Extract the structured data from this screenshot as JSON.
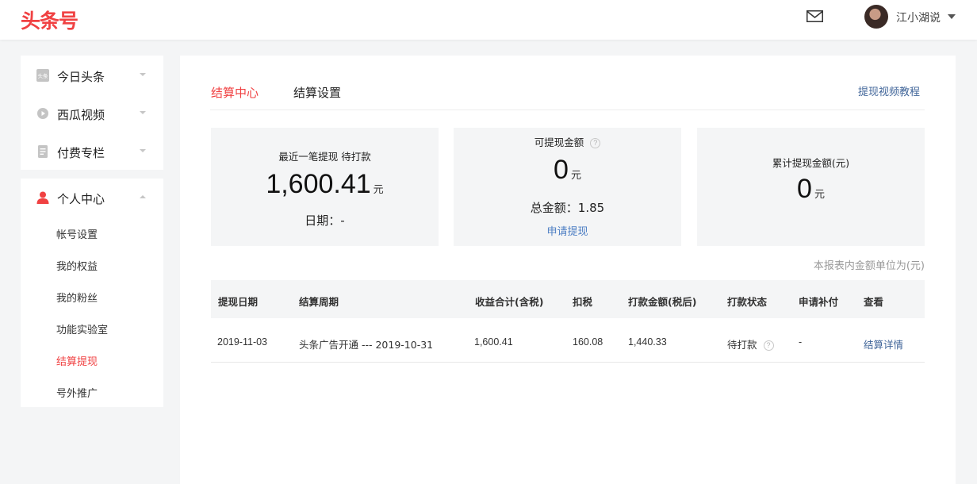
{
  "header": {
    "logo": "头条号",
    "username": "江小湖说"
  },
  "sidebar": {
    "group1": [
      {
        "label": "今日头条",
        "icon": "toutiao-icon"
      },
      {
        "label": "西瓜视频",
        "icon": "xigua-video-icon"
      },
      {
        "label": "付费专栏",
        "icon": "paid-column-icon"
      }
    ],
    "personal": {
      "label": "个人中心",
      "icon": "person-icon",
      "items": [
        "帐号设置",
        "我的权益",
        "我的粉丝",
        "功能实验室",
        "结算提现",
        "号外推广"
      ],
      "active_index": 4
    }
  },
  "main": {
    "tabs": [
      "结算中心",
      "结算设置"
    ],
    "active_tab": 0,
    "tutorial_link": "提现视频教程",
    "card_recent": {
      "title": "最近一笔提现 待打款",
      "amount": "1,600.41",
      "unit": "元",
      "date": "日期：-"
    },
    "card_withdrawable": {
      "title": "可提现金额",
      "help_icon": "?",
      "amount": "0",
      "unit": "元",
      "total": "总金额：1.85",
      "apply": "申请提现"
    },
    "card_cumulative": {
      "title": "累计提现金额(元)",
      "amount": "0",
      "unit": "元"
    },
    "unit_note": "本报表内金额单位为(元)",
    "table": {
      "headers": [
        "提现日期",
        "结算周期",
        "收益合计(含税)",
        "扣税",
        "打款金额(税后)",
        "打款状态",
        "申请补付",
        "查看"
      ],
      "rows": [
        {
          "date": "2019-11-03",
          "period": "头条广告开通 --- 2019-10-31",
          "income": "1,600.41",
          "tax": "160.08",
          "payout": "1,440.33",
          "status": "待打款",
          "supplement": "-",
          "view": "结算详情"
        }
      ]
    }
  },
  "colors": {
    "brand_red": "#f04142",
    "link_blue": "#406599",
    "apply_blue": "#4e7fc4",
    "page_bg": "#f4f5f6"
  }
}
